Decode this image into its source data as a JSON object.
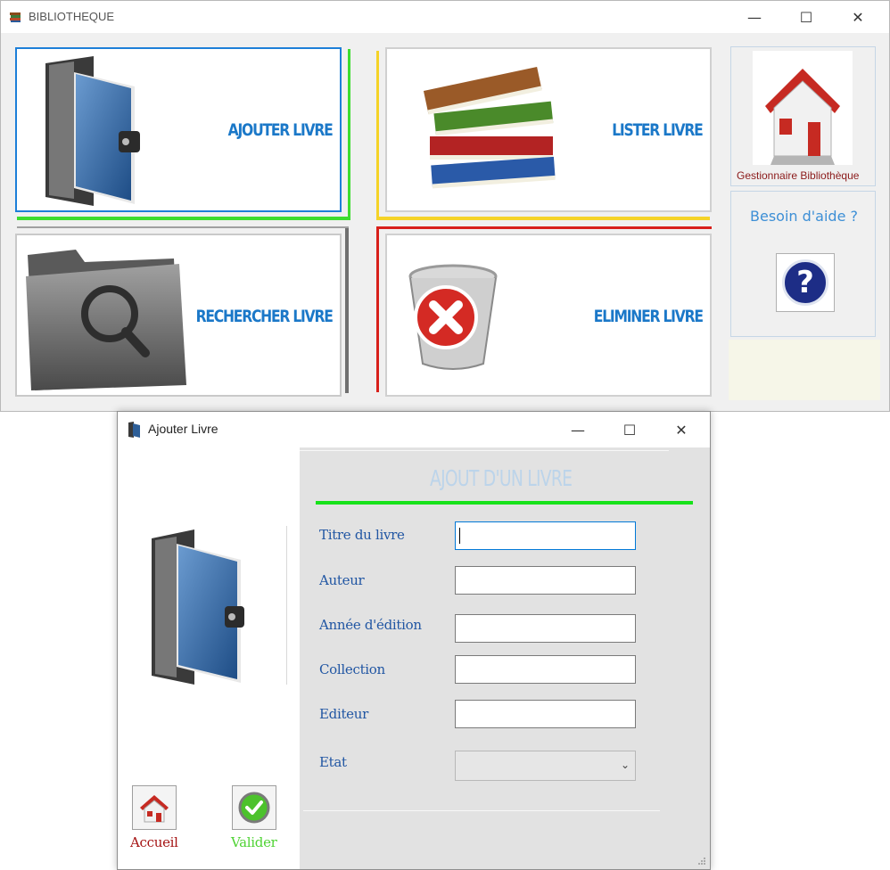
{
  "main_window": {
    "title": "BIBLIOTHEQUE",
    "controls": {
      "minimize": "—",
      "maximize": "☐",
      "close": "✕"
    },
    "tiles": {
      "add": {
        "label": "AJOUTER LIVRE",
        "accent": "#1d7fd8",
        "bar": "#3ddc2f"
      },
      "list": {
        "label": "LISTER LIVRE",
        "bar": "#f5d327"
      },
      "search": {
        "label": "RECHERCHER LIVRE",
        "bar": "#707070"
      },
      "delete": {
        "label": "ELIMINER LIVRE",
        "bar": "#d8201b"
      }
    },
    "gestionnaire_caption": "Gestionnaire Bibliothèque",
    "help": {
      "caption": "Besoin d'aide ?",
      "symbol": "?"
    }
  },
  "dialog": {
    "title": "Ajouter Livre",
    "controls": {
      "minimize": "—",
      "maximize": "☐",
      "close": "✕"
    },
    "section_title": "AJOUT D'UN LIVRE",
    "accent_bar_color": "#17e21a",
    "form": {
      "title_label": "Titre du livre",
      "title_value": "",
      "author_label": "Auteur",
      "author_value": "",
      "year_label": "Année d'édition",
      "year_value": "",
      "collection_label": "Collection",
      "collection_value": "",
      "publisher_label": "Editeur",
      "publisher_value": "",
      "state_label": "Etat",
      "state_value": ""
    },
    "buttons": {
      "home": {
        "caption": "Accueil",
        "color": "#a51414"
      },
      "validate": {
        "caption": "Valider",
        "color": "#4fd334"
      }
    }
  }
}
